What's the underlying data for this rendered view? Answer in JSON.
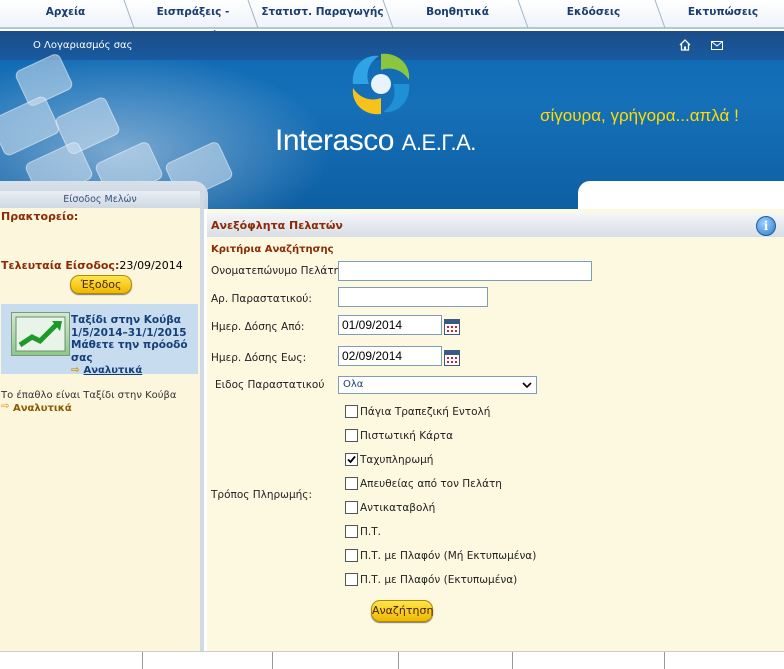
{
  "nav": {
    "tabs": [
      "Αρχεία",
      "Εισπράξεις - Πληρωμές",
      "Στατιστ. Παραγωγής",
      "Βοηθητικά",
      "Εκδόσεις",
      "Εκτυπώσεις"
    ]
  },
  "banner": {
    "account_label": "Ο Λογαριασμός σας",
    "brand": "Interasco",
    "brand_suffix": "Α.Ε.Γ.Α.",
    "slogan": "σίγουρα, γρήγορα...απλά !",
    "home_icon": "home-icon",
    "mail_icon": "mail-icon"
  },
  "sidebar": {
    "header": "Είσοδος Μελών",
    "agency_label": "Πρακτορείο:",
    "last_login_label": "Τελευταία Είσοδος:",
    "last_login_value": "23/09/2014",
    "logout_button": "Έξοδος",
    "promo": {
      "line1": "Ταξίδι στην Κούβα",
      "line2": "1/5/2014–31/1/2015",
      "line3": "Μάθετε την πρόοδό σας",
      "link": "Αναλυτικά"
    },
    "prize_text": "Το έπαθλο είναι Ταξίδι στην Κούβα",
    "prize_link": "Αναλυτικά"
  },
  "main": {
    "title": "Ανεξόφλητα Πελατών",
    "criteria_title": "Κριτήρια Αναζήτησης",
    "fields": {
      "customer_name_label": "Ονοματεπώνυμο Πελάτη:",
      "customer_name_value": "",
      "doc_number_label": "Αρ. Παραστατικού:",
      "doc_number_value": "",
      "date_from_label": "Ημερ. Δόσης Από:",
      "date_from_value": "01/09/2014",
      "date_to_label": "Ημερ. Δόσης Εως:",
      "date_to_value": "02/09/2014",
      "doc_type_label": "Ειδος Παραστατικού",
      "doc_type_value": "Ολα",
      "payment_method_label": "Τρόπος Πληρωμής:"
    },
    "payment_options": [
      {
        "label": "Πάγια Τραπεζική Εντολή",
        "checked": false
      },
      {
        "label": "Πιστωτική Κάρτα",
        "checked": false
      },
      {
        "label": "Ταχυπληρωμή",
        "checked": true
      },
      {
        "label": "Απευθείας από τον Πελάτη",
        "checked": false
      },
      {
        "label": "Αντικαταβολή",
        "checked": false
      },
      {
        "label": "Π.Τ.",
        "checked": false
      },
      {
        "label": "Π.Τ. με Πλαφόν (Μή Εκτυπωμένα)",
        "checked": false
      },
      {
        "label": "Π.Τ. με Πλαφόν (Εκτυπωμένα)",
        "checked": false
      }
    ],
    "search_button": "Αναζήτηση"
  },
  "colors": {
    "accent_title": "#8b2a05",
    "button_yellow": "#f0b800",
    "banner_blue": "#0f69b3",
    "slogan": "#ffdd00"
  }
}
